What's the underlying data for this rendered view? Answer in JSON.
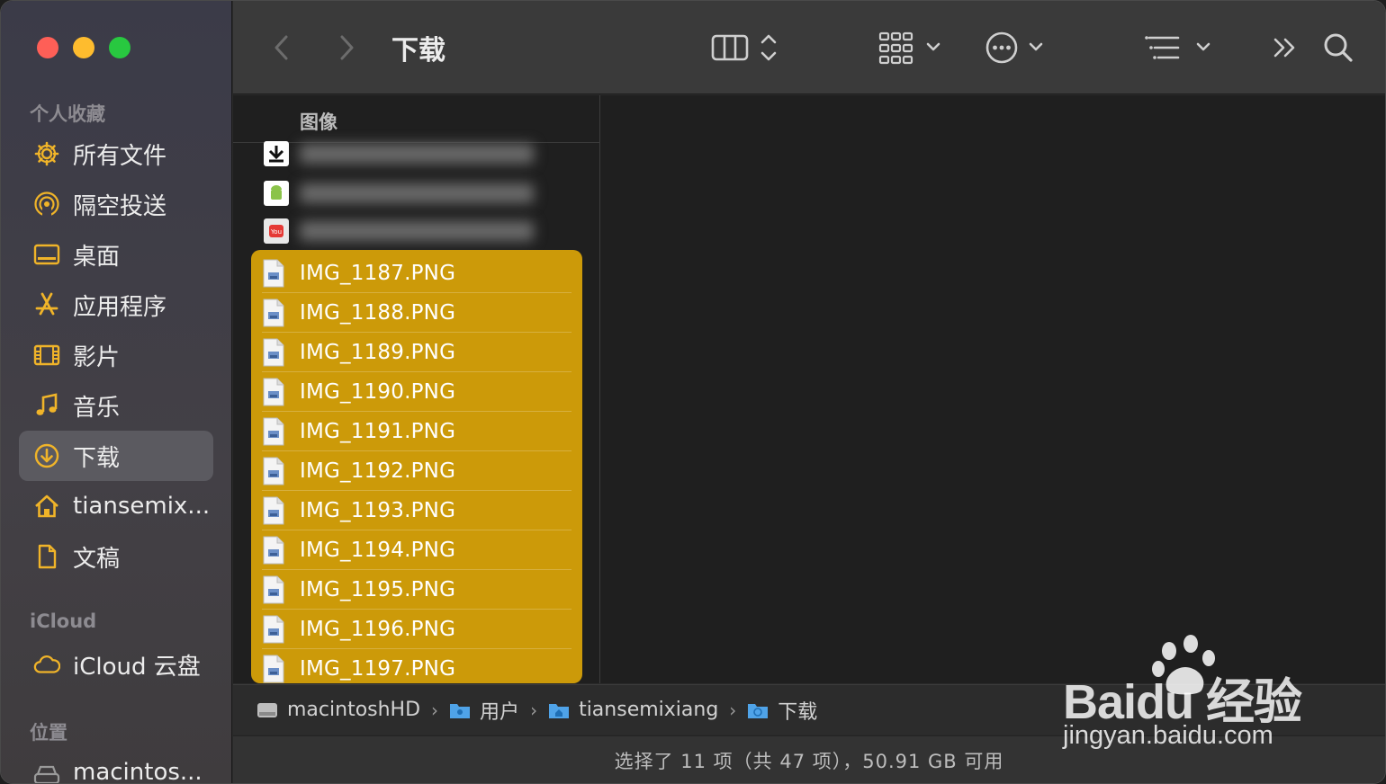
{
  "window": {
    "title": "下载"
  },
  "sidebar": {
    "favorites_header": "个人收藏",
    "items": [
      {
        "label": "所有文件",
        "icon": "gear-icon"
      },
      {
        "label": "隔空投送",
        "icon": "airdrop-icon"
      },
      {
        "label": "桌面",
        "icon": "desktop-icon"
      },
      {
        "label": "应用程序",
        "icon": "appstore-icon"
      },
      {
        "label": "影片",
        "icon": "film-icon"
      },
      {
        "label": "音乐",
        "icon": "music-note-icon"
      },
      {
        "label": "下载",
        "icon": "download-circle-icon",
        "active": true
      },
      {
        "label": "tiansemix...",
        "icon": "home-icon"
      },
      {
        "label": "文稿",
        "icon": "document-icon"
      }
    ],
    "icloud_header": "iCloud",
    "icloud_items": [
      {
        "label": "iCloud 云盘",
        "icon": "cloud-icon"
      }
    ],
    "locations_header": "位置",
    "location_items": [
      {
        "label": "macintos...",
        "icon": "disk-icon"
      }
    ]
  },
  "toolbar": {
    "back": "chevron-left-icon",
    "forward": "chevron-right-icon",
    "view": "column-view-icon",
    "group": "grid-group-icon",
    "action": "ellipsis-circle-icon",
    "sort": "list-sort-icon",
    "more": "double-chevron-icon",
    "search": "search-icon"
  },
  "column": {
    "header": "图像",
    "files": [
      "IMG_1187.PNG",
      "IMG_1188.PNG",
      "IMG_1189.PNG",
      "IMG_1190.PNG",
      "IMG_1191.PNG",
      "IMG_1192.PNG",
      "IMG_1193.PNG",
      "IMG_1194.PNG",
      "IMG_1195.PNG",
      "IMG_1196.PNG",
      "IMG_1197.PNG"
    ]
  },
  "pathbar": {
    "crumbs": [
      "macintoshHD",
      "用户",
      "tiansemixiang",
      "下载"
    ]
  },
  "statusbar": {
    "text": "选择了 11 项（共 47 项），50.91 GB 可用"
  },
  "watermark": {
    "main": "Baidu 经验",
    "sub": "jingyan.baidu.com"
  },
  "colors": {
    "selection": "#cc9a09",
    "accent": "#f0b429"
  }
}
